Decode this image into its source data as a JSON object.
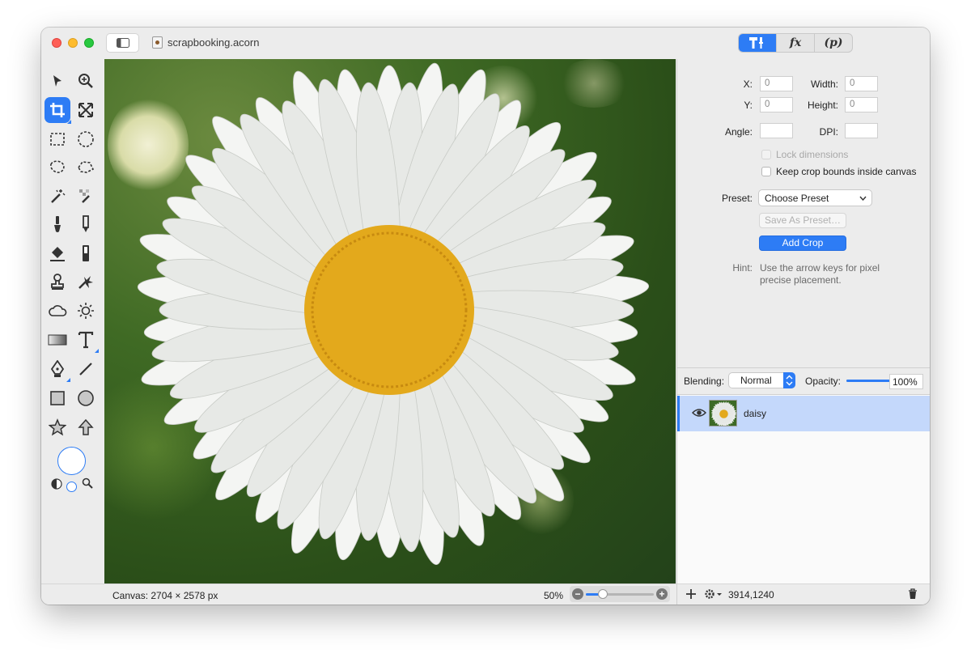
{
  "window": {
    "title": "scrapbooking.acorn",
    "inspector_tabs": [
      {
        "label": "",
        "icon": "tools-icon",
        "active": true
      },
      {
        "label": "fx",
        "active": false
      },
      {
        "label": "(p)",
        "active": false
      }
    ]
  },
  "tools": [
    {
      "name": "select-arrow-icon"
    },
    {
      "name": "zoom-icon"
    },
    {
      "name": "crop-icon",
      "selected": true
    },
    {
      "name": "transform-icon"
    },
    {
      "name": "rect-select-icon"
    },
    {
      "name": "ellipse-select-icon"
    },
    {
      "name": "lasso-icon"
    },
    {
      "name": "polygon-lasso-icon"
    },
    {
      "name": "magic-wand-icon"
    },
    {
      "name": "magic-wand-color-icon"
    },
    {
      "name": "brush-icon"
    },
    {
      "name": "pencil-icon"
    },
    {
      "name": "paint-bucket-icon"
    },
    {
      "name": "eraser-icon"
    },
    {
      "name": "clone-stamp-icon"
    },
    {
      "name": "retouch-icon"
    },
    {
      "name": "cloud-icon"
    },
    {
      "name": "sun-icon"
    },
    {
      "name": "gradient-icon"
    },
    {
      "name": "text-icon"
    },
    {
      "name": "pen-icon"
    },
    {
      "name": "line-icon"
    },
    {
      "name": "rectangle-shape-icon"
    },
    {
      "name": "circle-shape-icon"
    },
    {
      "name": "star-icon"
    },
    {
      "name": "arrow-shape-icon"
    }
  ],
  "crop": {
    "x_label": "X:",
    "x_value": "0",
    "y_label": "Y:",
    "y_value": "0",
    "width_label": "Width:",
    "width_value": "0",
    "height_label": "Height:",
    "height_value": "0",
    "angle_label": "Angle:",
    "angle_value": "",
    "dpi_label": "DPI:",
    "dpi_value": "",
    "lock_label": "Lock dimensions",
    "keep_label": "Keep crop bounds inside canvas",
    "preset_label": "Preset:",
    "preset_value": "Choose Preset",
    "save_preset_label": "Save As Preset…",
    "add_crop_label": "Add Crop",
    "hint_label": "Hint:",
    "hint_text_1": "Use the arrow keys for pixel",
    "hint_text_2": "precise placement."
  },
  "layers": {
    "blending_label": "Blending:",
    "blending_value": "Normal",
    "opacity_label": "Opacity:",
    "opacity_value": "100%",
    "opacity_fraction": 1.0,
    "items": [
      {
        "name": "daisy",
        "visible": true,
        "selected": true
      }
    ]
  },
  "status": {
    "canvas_text": "Canvas: 2704 × 2578 px",
    "zoom_text": "50%",
    "zoom_fraction": 0.25,
    "coords_text": "3914,1240"
  },
  "colors": {
    "accent": "#2d7cf5",
    "petal": "#f4f5f3",
    "center": "#e3a91c",
    "background_green": "#3f6a24"
  }
}
